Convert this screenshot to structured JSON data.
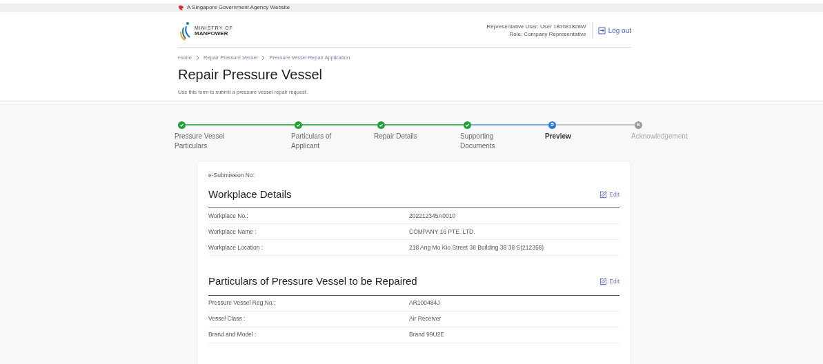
{
  "masthead": {
    "text": "A Singapore Government Agency Website"
  },
  "header": {
    "logo_lines": [
      "MINISTRY OF",
      "MANPOWER"
    ],
    "user": "Representative User: User 180081828W",
    "role": "Role: Company Representative",
    "logout": "Log out"
  },
  "breadcrumb": [
    "Home",
    "Repair Pressure Vessel",
    "Pressure Vessel Repair Application"
  ],
  "page": {
    "title": "Repair Pressure Vessel",
    "subtitle": "Use this form to submit a pressure vessel repair request."
  },
  "steps": [
    {
      "label": "Pressure Vessel Particulars",
      "completed": true,
      "selected": false
    },
    {
      "label": "Particulars of Applicant",
      "completed": true,
      "selected": false
    },
    {
      "label": "Repair Details",
      "completed": true,
      "selected": false
    },
    {
      "label": "Supporting Documents",
      "completed": true,
      "selected": false
    },
    {
      "number": "5",
      "label": "Preview",
      "completed": false,
      "selected": true
    },
    {
      "number": "6",
      "label": "Acknowledgement",
      "completed": false,
      "selected": false
    }
  ],
  "card": {
    "submission_label": "e-Submission No:",
    "sections": [
      {
        "title": "Workplace Details",
        "edit": "Edit",
        "rows": [
          {
            "label": "Workplace No.:",
            "value": "202212345A0010"
          },
          {
            "label": "Workplace Name :",
            "value": "COMPANY 16 PTE. LTD."
          },
          {
            "label": "Workplace Location :",
            "value": "218 Ang Mo Kio Street 38 Building 38 38 S(212358)"
          }
        ]
      },
      {
        "title": "Particulars of Pressure Vessel to be Repaired",
        "edit": "Edit",
        "rows": [
          {
            "label": "Pressure Vessel Reg No.:",
            "value": "AR100484J"
          },
          {
            "label": "Vessel Class :",
            "value": "Air Receiver"
          },
          {
            "label": "Brand and Model :",
            "value": "Brand 99U2E"
          }
        ]
      }
    ]
  }
}
